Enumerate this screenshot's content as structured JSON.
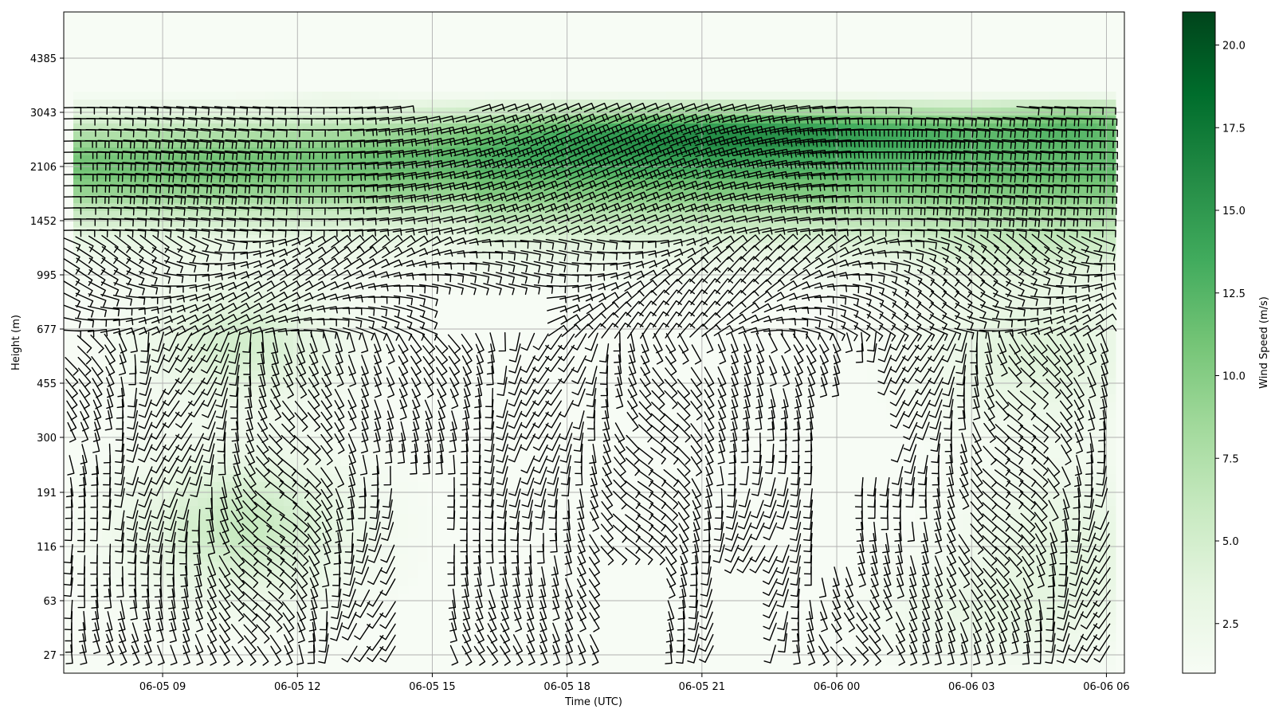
{
  "chart_data": {
    "type": "heatmap",
    "title": "",
    "xlabel": "Time (UTC)",
    "ylabel": "Height (m)",
    "colorbar_label": "Wind Speed (m/s)",
    "colormap": "Greens",
    "color_low": "#f7fcf5",
    "color_high": "#00441b",
    "grid": true,
    "x_ticks": [
      "06-05 09",
      "06-05 12",
      "06-05 15",
      "06-05 18",
      "06-05 21",
      "06-06 00",
      "06-06 03",
      "06-06 06"
    ],
    "xlim_hours": [
      6.8,
      30.4
    ],
    "x_tick_hours": [
      9,
      12,
      15,
      18,
      21,
      24,
      27,
      30
    ],
    "y_ticks": [
      "27",
      "63",
      "116",
      "191",
      "300",
      "455",
      "677",
      "995",
      "1452",
      "2106",
      "3043",
      "4385"
    ],
    "colorbar_ticks": [
      "2.5",
      "5.0",
      "7.5",
      "10.0",
      "12.5",
      "15.0",
      "17.5",
      "20.0"
    ],
    "colorbar_range": [
      1.0,
      21.0
    ],
    "wind_speed_field": [
      {
        "height": 3043,
        "max_speed": 20.5,
        "time_range_hours": [
          19.5,
          24.0
        ]
      },
      {
        "height": 2600,
        "max_speed": 18.0,
        "time_range_hours": [
          16.5,
          30.0
        ]
      },
      {
        "height": 2106,
        "max_speed": 14.0,
        "time_range_hours": [
          7.0,
          30.0
        ]
      },
      {
        "height": 1452,
        "max_speed": 10.0,
        "time_range_hours": [
          7.0,
          30.0
        ]
      },
      {
        "height": 677,
        "max_speed": 8.0,
        "time_range_hours": [
          9.5,
          12.5
        ]
      },
      {
        "height": 150,
        "max_speed": 7.0,
        "time_range_hours": [
          9.0,
          12.5
        ]
      }
    ]
  }
}
